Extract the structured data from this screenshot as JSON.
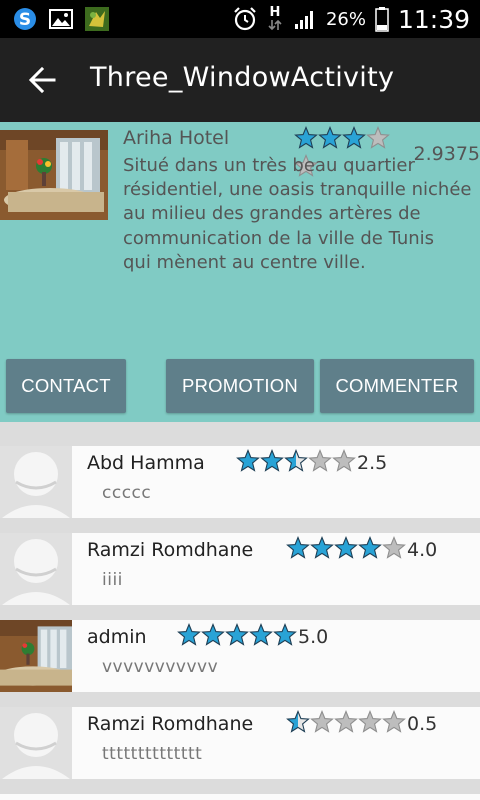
{
  "status_bar": {
    "battery": "26%",
    "time": "11:39",
    "network_label": "H",
    "icons": [
      "skype-icon",
      "gallery-icon",
      "game-icon",
      "alarm-icon",
      "data-arrows-icon",
      "signal-icon",
      "battery-icon"
    ]
  },
  "app_bar": {
    "title": "Three_WindowActivity",
    "back_icon": "back-arrow-icon"
  },
  "hotel": {
    "name": "Ariha Hotel",
    "rating": 2.9375,
    "rating_text": "2.9375",
    "description_lines": [
      "Situé dans un très beau quartier",
      "résidentiel, une oasis tranquille nichée",
      "au milieu des grandes artères de",
      "communication de la ville de Tunis",
      "qui mènent au centre ville."
    ],
    "buttons": {
      "contact": "CONTACT",
      "promotion": "PROMOTION",
      "commenter": "COMMENTER"
    }
  },
  "reviews": [
    {
      "name": "Abd Hamma",
      "rating": 2.5,
      "rating_text": "2.5",
      "comment": "ccccc",
      "avatar": "default"
    },
    {
      "name": "Ramzi Romdhane",
      "rating": 4.0,
      "rating_text": "4.0",
      "comment": "iiii",
      "avatar": "default"
    },
    {
      "name": "admin",
      "rating": 5.0,
      "rating_text": "5.0",
      "comment": "vvvvvvvvvvv",
      "avatar": "hotel-photo"
    },
    {
      "name": "Ramzi Romdhane",
      "rating": 0.5,
      "rating_text": "0.5",
      "comment": "tttttttttttttt",
      "avatar": "default"
    }
  ],
  "colors": {
    "status_bar": "#000000",
    "app_bar": "#212121",
    "card_background": "#80cbc4",
    "button": "#5f7f8a",
    "star_filled": "#29a3d6",
    "star_empty": "#bdbdbd",
    "list_background": "#dcdcdc",
    "row_background": "#fbfbfb"
  }
}
